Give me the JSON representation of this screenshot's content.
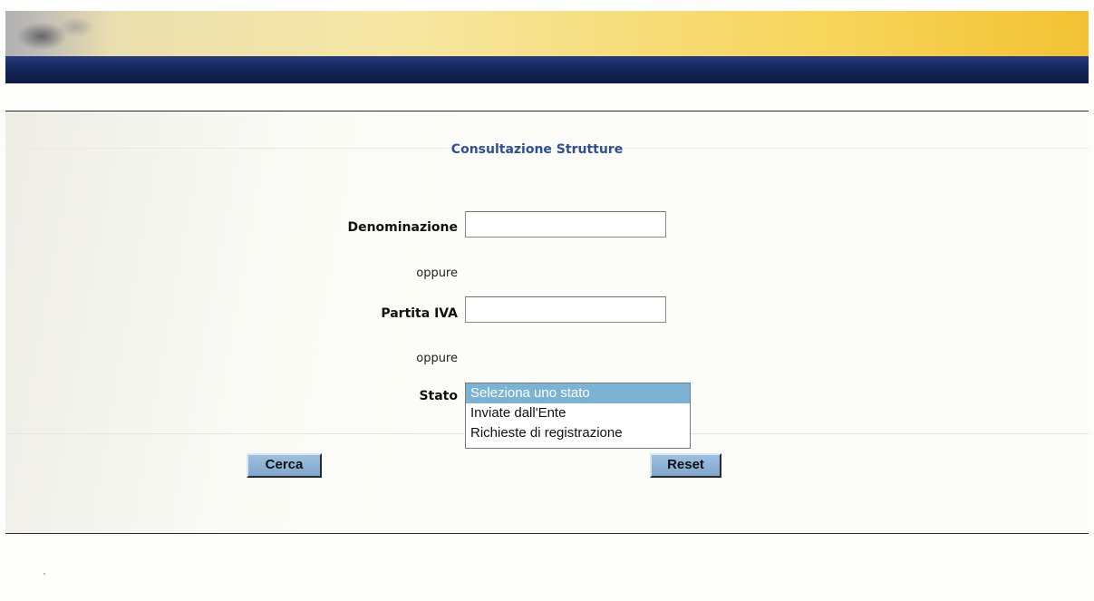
{
  "header": {
    "banner_image": "building-photo-banner",
    "nav_bar_color": "#16265c"
  },
  "form": {
    "title": "Consultazione Strutture",
    "denominazione": {
      "label": "Denominazione",
      "value": "",
      "placeholder": ""
    },
    "separator_1": "oppure",
    "partita_iva": {
      "label": "Partita IVA",
      "value": "",
      "placeholder": ""
    },
    "separator_2": "oppure",
    "stato": {
      "label": "Stato",
      "options": [
        {
          "label": "Seleziona uno stato",
          "selected": true
        },
        {
          "label": "Inviate dall'Ente",
          "selected": false
        },
        {
          "label": "Richieste di registrazione",
          "selected": false
        }
      ]
    }
  },
  "buttons": {
    "search_label": "Cerca",
    "reset_label": "Reset"
  },
  "colors": {
    "title": "#2f4f9a",
    "button_bg": "#8fb3d6",
    "selected_option": "#7bb3d4"
  }
}
